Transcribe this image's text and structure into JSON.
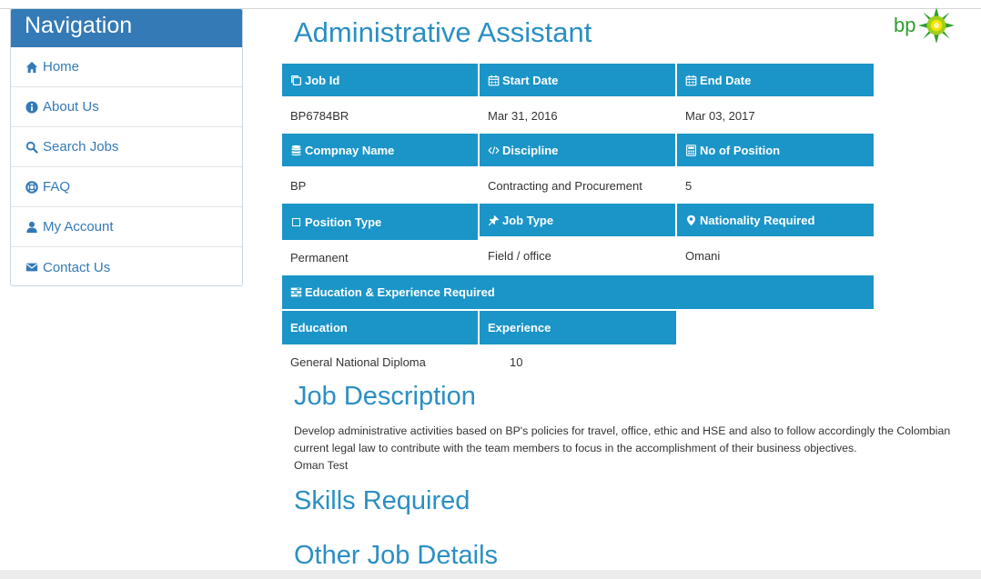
{
  "navigation": {
    "title": "Navigation",
    "items": [
      {
        "label": "Home",
        "icon": "home-icon"
      },
      {
        "label": "About Us",
        "icon": "info-icon"
      },
      {
        "label": "Search Jobs",
        "icon": "search-icon"
      },
      {
        "label": "FAQ",
        "icon": "lifebuoy-icon"
      },
      {
        "label": "My Account",
        "icon": "user-icon"
      },
      {
        "label": "Contact Us",
        "icon": "envelope-icon"
      }
    ]
  },
  "logo": {
    "text": "bp"
  },
  "job": {
    "title": "Administrative Assistant",
    "headers": {
      "job_id": "Job Id",
      "start_date": "Start Date",
      "end_date": "End Date",
      "company_name": "Compnay Name",
      "discipline": "Discipline",
      "no_of_position": "No of Position",
      "position_type": "Position Type",
      "job_type": "Job Type",
      "nationality": "Nationality Required",
      "edu_exp": "Education & Experience Required",
      "education": "Education",
      "experience": "Experience"
    },
    "values": {
      "job_id": "BP6784BR",
      "start_date": "Mar 31, 2016",
      "end_date": "Mar 03, 2017",
      "company_name": "BP",
      "discipline": "Contracting and Procurement",
      "no_of_position": "5",
      "position_type": "Permanent",
      "job_type": "Field / office",
      "nationality": "Omani",
      "education": "General National Diploma",
      "experience": "10"
    }
  },
  "sections": {
    "job_description": "Job Description",
    "description_text": "Develop administrative activities based on BP's policies for travel, office, ethic and HSE and also to follow accordingly the Colombian current legal law to contribute with the team members to focus in the accomplishment of their business objectives.",
    "description_note": "Oman Test",
    "skills_required": "Skills Required",
    "other_job_details": "Other Job Details"
  },
  "colors": {
    "nav_header": "#347ab7",
    "table_header": "#1b95c8",
    "heading": "#2a8fc2",
    "link": "#337ab7"
  }
}
